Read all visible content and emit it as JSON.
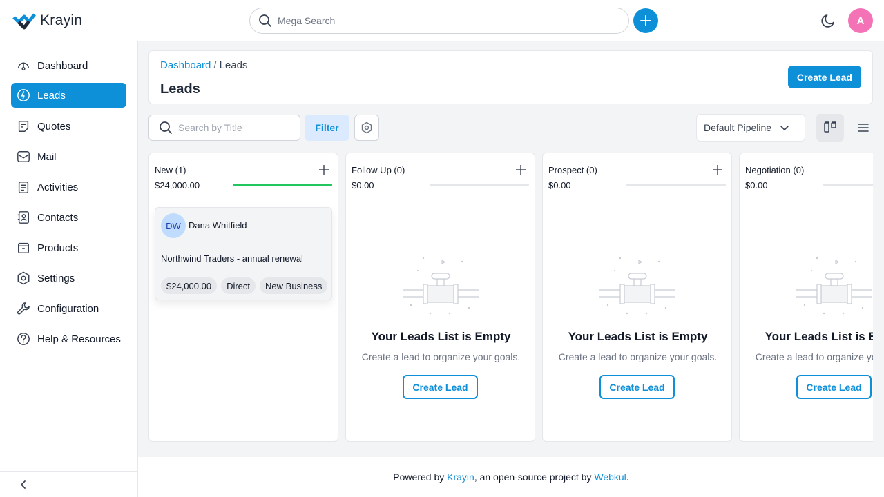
{
  "header": {
    "logo_text": "Krayin",
    "search_placeholder": "Mega Search",
    "avatar_letter": "A",
    "brand_color": "#0e90d9",
    "avatar_color": "#f472b6"
  },
  "sidebar": {
    "items": [
      {
        "label": "Dashboard",
        "icon": "dashboard-icon"
      },
      {
        "label": "Leads",
        "icon": "leads-icon",
        "active": true
      },
      {
        "label": "Quotes",
        "icon": "quotes-icon"
      },
      {
        "label": "Mail",
        "icon": "mail-icon"
      },
      {
        "label": "Activities",
        "icon": "activities-icon"
      },
      {
        "label": "Contacts",
        "icon": "contacts-icon"
      },
      {
        "label": "Products",
        "icon": "products-icon"
      },
      {
        "label": "Settings",
        "icon": "settings-icon"
      },
      {
        "label": "Configuration",
        "icon": "wrench-icon"
      },
      {
        "label": "Help & Resources",
        "icon": "help-icon"
      }
    ]
  },
  "page": {
    "breadcrumb_root": "Dashboard",
    "breadcrumb_sep": "/",
    "breadcrumb_current": "Leads",
    "title": "Leads",
    "create_label": "Create Lead"
  },
  "toolbar": {
    "search_placeholder": "Search by Title",
    "filter_label": "Filter",
    "pipeline": "Default Pipeline"
  },
  "columns": [
    {
      "title": "New (1)",
      "amount": "$24,000.00",
      "progress": 1.0
    },
    {
      "title": "Follow Up (0)",
      "amount": "$0.00",
      "progress": 0
    },
    {
      "title": "Prospect (0)",
      "amount": "$0.00",
      "progress": 0
    },
    {
      "title": "Negotiation (0)",
      "amount": "$0.00",
      "progress": 0
    }
  ],
  "lead": {
    "initials": "DW",
    "name": "Dana Whitfield",
    "title": "Northwind Traders - annual renewal",
    "value": "$24,000.00",
    "source": "Direct",
    "type": "New Business"
  },
  "empty": {
    "title": "Your Leads List is Empty",
    "subtitle": "Create a lead to organize your goals.",
    "button": "Create Lead"
  },
  "footer": {
    "prefix": "Powered by ",
    "krayin": "Krayin",
    "middle": ", an open-source project by ",
    "webkul": "Webkul",
    "suffix": "."
  }
}
